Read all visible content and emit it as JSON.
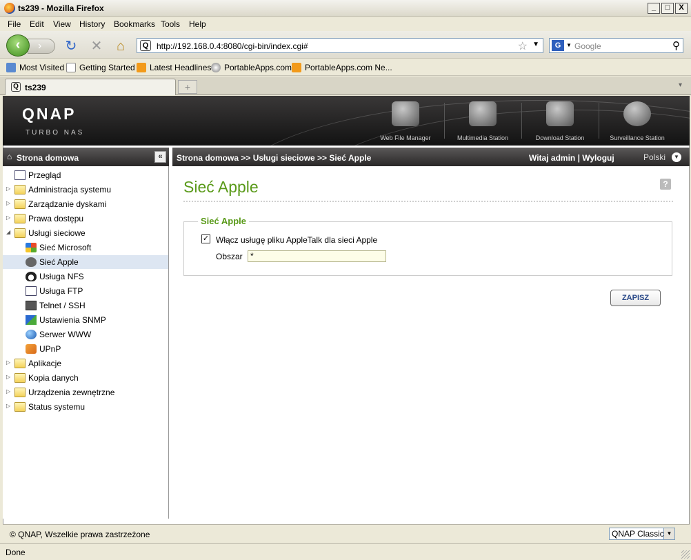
{
  "window": {
    "title": "ts239 - Mozilla Firefox",
    "minimize": "_",
    "maximize": "□",
    "close": "X"
  },
  "menu": [
    "File",
    "Edit",
    "View",
    "History",
    "Bookmarks",
    "Tools",
    "Help"
  ],
  "toolbar": {
    "url": "http://192.168.0.4:8080/cgi-bin/index.cgi#",
    "search_placeholder": "Google"
  },
  "bookmarks": [
    "Most Visited",
    "Getting Started",
    "Latest Headlines",
    "PortableApps.com",
    "PortableApps.com Ne..."
  ],
  "tab": {
    "label": "ts239",
    "new_tab": "+"
  },
  "banner": {
    "logo": "QNAP",
    "sub": "TURBO NAS",
    "apps": [
      "Web File Manager",
      "Multimedia Station",
      "Download Station",
      "Surveillance Station"
    ]
  },
  "sidebar": {
    "title": "Strona domowa",
    "collapse": "«",
    "items": [
      {
        "label": "Przegląd",
        "level": 0,
        "type": "page"
      },
      {
        "label": "Administracja systemu",
        "level": 0,
        "type": "folder"
      },
      {
        "label": "Zarządzanie dyskami",
        "level": 0,
        "type": "folder"
      },
      {
        "label": "Prawa dostępu",
        "level": 0,
        "type": "folder"
      },
      {
        "label": "Usługi sieciowe",
        "level": 0,
        "type": "folder-open"
      },
      {
        "label": "Sieć Microsoft",
        "level": 1,
        "type": "windows"
      },
      {
        "label": "Sieć Apple",
        "level": 1,
        "type": "apple",
        "selected": true
      },
      {
        "label": "Usługa NFS",
        "level": 1,
        "type": "linux"
      },
      {
        "label": "Usługa FTP",
        "level": 1,
        "type": "ftp"
      },
      {
        "label": "Telnet / SSH",
        "level": 1,
        "type": "terminal"
      },
      {
        "label": "Ustawienia SNMP",
        "level": 1,
        "type": "snmp"
      },
      {
        "label": "Serwer WWW",
        "level": 1,
        "type": "globe"
      },
      {
        "label": "UPnP",
        "level": 1,
        "type": "upnp"
      },
      {
        "label": "Aplikacje",
        "level": 0,
        "type": "folder"
      },
      {
        "label": "Kopia danych",
        "level": 0,
        "type": "folder"
      },
      {
        "label": "Urządzenia zewnętrzne",
        "level": 0,
        "type": "folder"
      },
      {
        "label": "Status systemu",
        "level": 0,
        "type": "folder"
      }
    ]
  },
  "header": {
    "breadcrumb": "Strona domowa >> Usługi sieciowe >> Sieć Apple",
    "welcome": "Witaj admin | Wyloguj",
    "language": "Polski"
  },
  "main": {
    "title": "Sieć Apple",
    "help": "?",
    "section_title": "Sieć Apple",
    "checkbox_label": "Włącz usługę pliku AppleTalk dla sieci Apple",
    "checkbox_checked": true,
    "checkmark": "✓",
    "zone_label": "Obszar",
    "zone_value": "*",
    "save_label": "ZAPISZ"
  },
  "footer": {
    "copyright": "© QNAP, Wszelkie prawa zastrzeżone",
    "theme": "QNAP Classic"
  },
  "status": {
    "text": "Done"
  }
}
